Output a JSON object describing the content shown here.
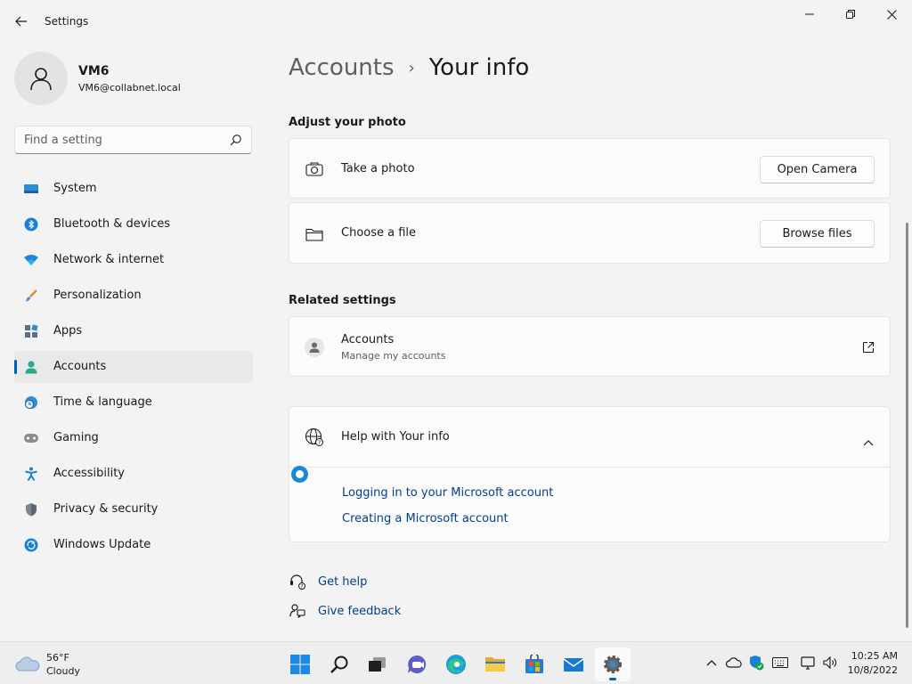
{
  "window": {
    "title": "Settings"
  },
  "profile": {
    "name": "VM6",
    "email": "VM6@collabnet.local"
  },
  "search": {
    "placeholder": "Find a setting"
  },
  "sidebar": {
    "items": [
      {
        "label": "System",
        "icon": "monitor-icon"
      },
      {
        "label": "Bluetooth & devices",
        "icon": "bluetooth-icon"
      },
      {
        "label": "Network & internet",
        "icon": "wifi-icon"
      },
      {
        "label": "Personalization",
        "icon": "brush-icon"
      },
      {
        "label": "Apps",
        "icon": "apps-icon"
      },
      {
        "label": "Accounts",
        "icon": "person-icon",
        "active": true
      },
      {
        "label": "Time & language",
        "icon": "clock-globe-icon"
      },
      {
        "label": "Gaming",
        "icon": "gamepad-icon"
      },
      {
        "label": "Accessibility",
        "icon": "accessibility-icon"
      },
      {
        "label": "Privacy & security",
        "icon": "shield-icon"
      },
      {
        "label": "Windows Update",
        "icon": "update-icon"
      }
    ]
  },
  "breadcrumb": {
    "parent": "Accounts",
    "separator": "›",
    "current": "Your info"
  },
  "photo": {
    "section_title": "Adjust your photo",
    "take_photo_label": "Take a photo",
    "open_camera_button": "Open Camera",
    "choose_file_label": "Choose a file",
    "browse_files_button": "Browse files"
  },
  "related": {
    "section_title": "Related settings",
    "accounts_label": "Accounts",
    "accounts_sub": "Manage my accounts"
  },
  "help": {
    "title": "Help with Your info",
    "links": [
      "Logging in to your Microsoft account",
      "Creating a Microsoft account"
    ]
  },
  "footer": {
    "get_help": "Get help",
    "give_feedback": "Give feedback"
  },
  "taskbar": {
    "weather_temp": "56°F",
    "weather_condition": "Cloudy",
    "time": "10:25 AM",
    "date": "10/8/2022"
  },
  "colors": {
    "accent": "#005fb8",
    "link": "#003e92",
    "background": "#f3f3f3",
    "card": "#fbfbfb"
  }
}
